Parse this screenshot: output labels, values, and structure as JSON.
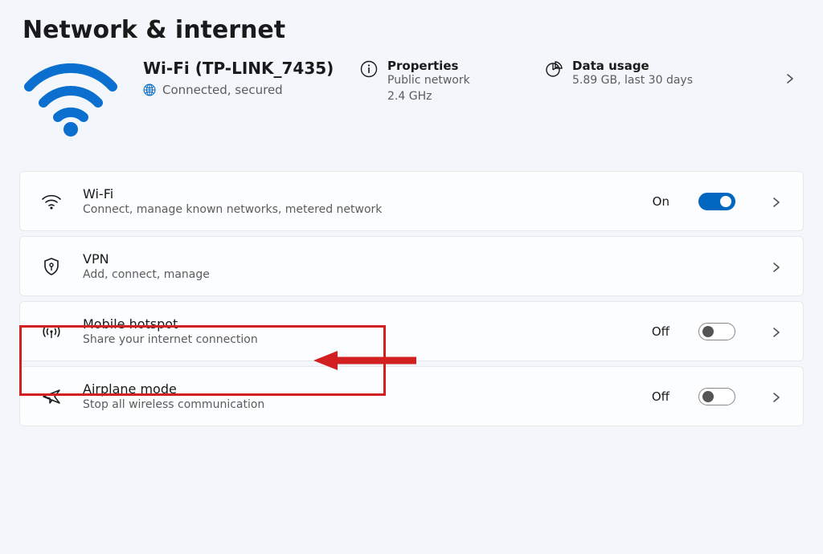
{
  "page_title": "Network & internet",
  "hero": {
    "title": "Wi-Fi (TP-LINK_7435)",
    "status": "Connected, secured"
  },
  "properties": {
    "title": "Properties",
    "line1": "Public network",
    "line2": "2.4 GHz"
  },
  "data_usage": {
    "title": "Data usage",
    "value": "5.89 GB, last 30 days"
  },
  "rows": {
    "wifi": {
      "title": "Wi-Fi",
      "sub": "Connect, manage known networks, metered network",
      "state": "On"
    },
    "vpn": {
      "title": "VPN",
      "sub": "Add, connect, manage"
    },
    "hotspot": {
      "title": "Mobile hotspot",
      "sub": "Share your internet connection",
      "state": "Off"
    },
    "airplane": {
      "title": "Airplane mode",
      "sub": "Stop all wireless communication",
      "state": "Off"
    }
  }
}
